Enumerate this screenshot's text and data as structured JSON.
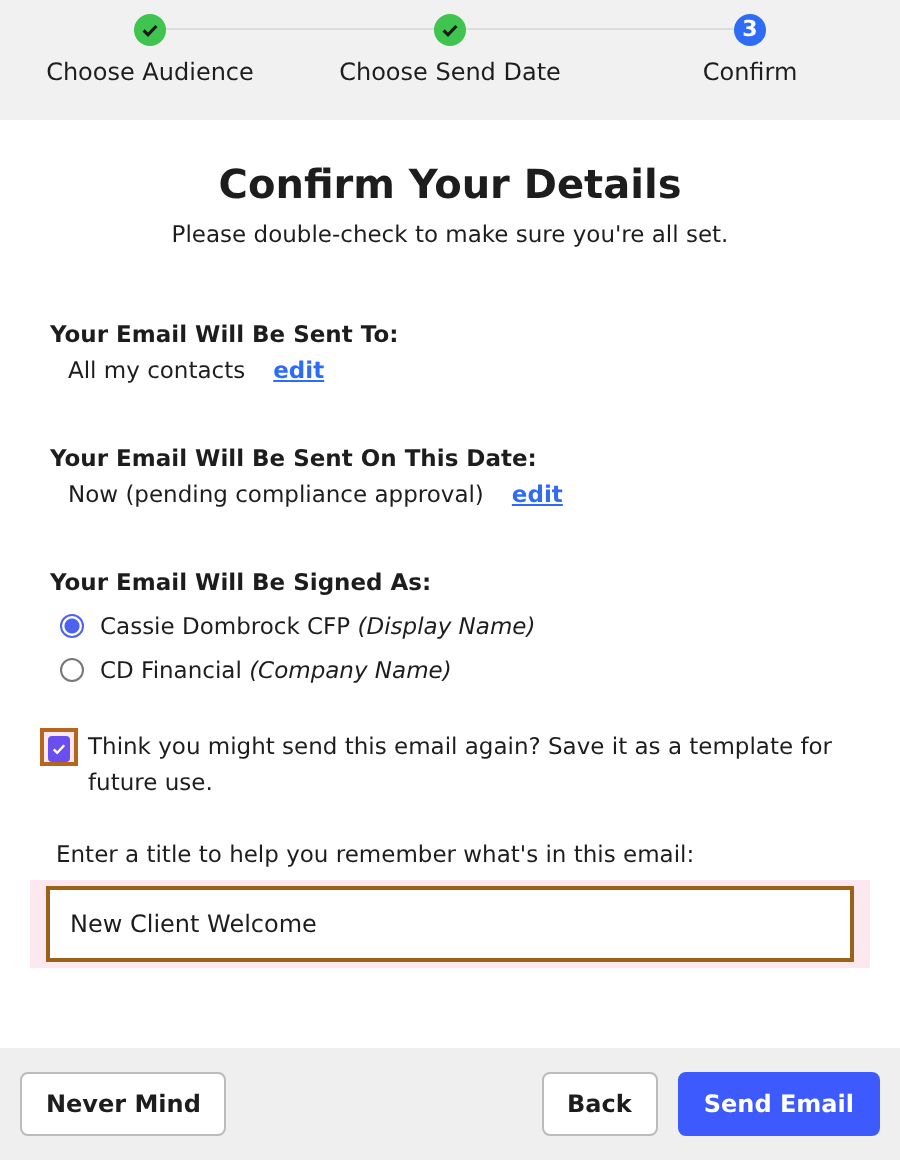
{
  "steps": [
    {
      "label": "Choose Audience",
      "kind": "done"
    },
    {
      "label": "Choose Send Date",
      "kind": "done"
    },
    {
      "label": "Confirm",
      "kind": "current",
      "number": "3"
    }
  ],
  "title": "Confirm Your Details",
  "subtitle": "Please double-check to make sure you're all set.",
  "details": [
    {
      "heading": "Your Email Will Be Sent To:",
      "value": "All my contacts",
      "link": "edit"
    },
    {
      "heading": "Your Email Will Be Sent On This Date:",
      "value": "Now (pending compliance approval)",
      "link": "edit"
    }
  ],
  "signature": {
    "heading": "Your Email Will Be Signed As:",
    "options": [
      {
        "label": "Cassie Dombrock CFP *(Display Name)*",
        "selected": true
      },
      {
        "label": "CD Financial *(Company Name)*",
        "selected": false
      }
    ]
  },
  "template": {
    "checked": true,
    "label": "Think you might send this email again? Save it as a template for future use.",
    "field_label": "Enter a title to help you remember what's in this email:",
    "value": "New Client Welcome"
  },
  "buttons": {
    "cancel": "Never Mind",
    "back": "Back",
    "send": "Send Email"
  }
}
